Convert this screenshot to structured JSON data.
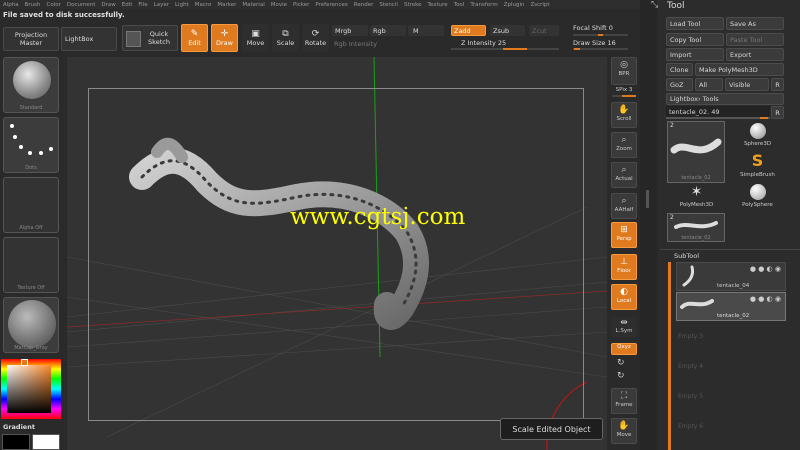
{
  "menu": [
    "Alpha",
    "Brush",
    "Color",
    "Document",
    "Draw",
    "Edit",
    "File",
    "Layer",
    "Light",
    "Macro",
    "Marker",
    "Material",
    "Movie",
    "Picker",
    "Preferences",
    "Render",
    "Stencil",
    "Stroke",
    "Texture",
    "Tool",
    "Transform",
    "Zplugin",
    "Zscript"
  ],
  "status_message": "File saved to disk successfully.",
  "toolbar": {
    "projection_master": "Projection Master",
    "lightbox": "LightBox",
    "quick_sketch": "Quick Sketch",
    "edit": "Edit",
    "draw": "Draw",
    "move": "Move",
    "scale": "Scale",
    "rotate": "Rotate",
    "mrgb": "Mrgb",
    "rgb": "Rgb",
    "m": "M",
    "rgb_intensity": "Rgb Intensity",
    "zadd": "Zadd",
    "zsub": "Zsub",
    "zcut": "Zcut",
    "z_intensity": "Z Intensity 25",
    "focal_shift": "Focal Shift 0",
    "draw_size": "Draw Size 16"
  },
  "left_shelf": {
    "brush": "Standard",
    "stroke": "Dots",
    "alpha": "Alpha Off",
    "texture": "Texture Off",
    "material": "MatCap_Gray",
    "gradient": "Gradient"
  },
  "right_shelf": [
    "BPR",
    "SPix 3",
    "Scroll",
    "Zoom",
    "Actual",
    "AAHalf",
    "Persp",
    "Floor",
    "Local",
    "L.Sym",
    "Qxyz",
    "Frame",
    "Move"
  ],
  "viewport": {
    "watermark": "www.cgtsj.com",
    "tooltip": "Scale Edited Object"
  },
  "tool_panel": {
    "title": "Tool",
    "load_tool": "Load Tool",
    "save_as": "Save As",
    "copy_tool": "Copy Tool",
    "paste_tool": "Paste Tool",
    "import": "Import",
    "export": "Export",
    "clone": "Clone",
    "make_polymesh": "Make PolyMesh3D",
    "goz": "GoZ",
    "all": "All",
    "visible": "Visible",
    "r": "R",
    "lightbox_tools": "Lightbox› Tools",
    "current_tool": "tentacle_02. 49",
    "thumbs": [
      {
        "label": "tentacle_02",
        "badge": "2"
      },
      {
        "label": "Sphere3D"
      },
      {
        "label": "SimpleBrush"
      },
      {
        "label": "PolyMesh3D"
      },
      {
        "label": "PolySphere"
      },
      {
        "label": "tentacle_02",
        "badge": "2"
      }
    ],
    "subtool_title": "SubTool",
    "subtools": [
      "tentacle_04",
      "tentacle_02"
    ],
    "empty_slots": [
      "Empty 3",
      "Empty 4",
      "Empty 5",
      "Empty 6",
      "Empty 7",
      "Empty 8"
    ]
  }
}
